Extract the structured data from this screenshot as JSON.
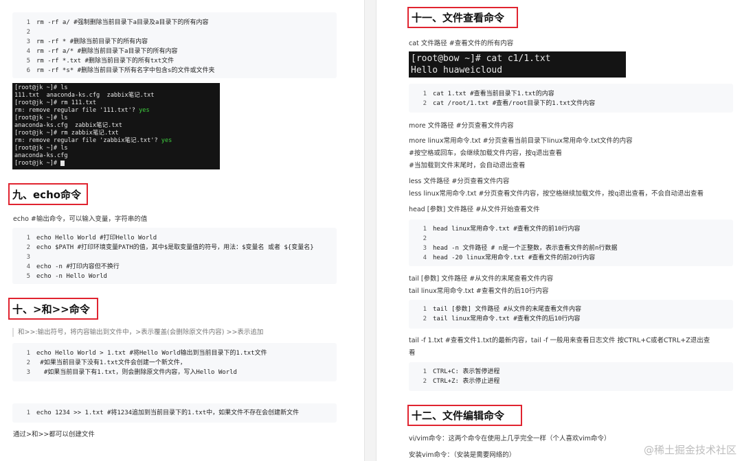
{
  "left": {
    "code1": [
      {
        "n": "1",
        "t": "rm -rf a/ #强制删除当前目录下a目录及a目录下的所有内容"
      },
      {
        "n": "2",
        "t": ""
      },
      {
        "n": "3",
        "t": "rm -rf * #删除当前目录下的所有内容"
      },
      {
        "n": "4",
        "t": "rm -rf a/* #删除当前目录下a目录下的所有内容"
      },
      {
        "n": "5",
        "t": "rm -rf *.txt #删除当前目录下的所有txt文件"
      },
      {
        "n": "6",
        "t": "rm -rf *s* #删除当前目录下所有名字中包含s的文件或文件夹"
      }
    ],
    "terminal1": [
      {
        "t": "[root@jk ~]# ls"
      },
      {
        "t": "111.txt  anaconda-ks.cfg  zabbix笔记.txt"
      },
      {
        "t": "[root@jk ~]# rm 111.txt"
      },
      {
        "t": "rm: remove regular file '111.txt'? ",
        "y": "yes"
      },
      {
        "t": "[root@jk ~]# ls"
      },
      {
        "t": "anaconda-ks.cfg  zabbix笔记.txt"
      },
      {
        "t": "[root@jk ~]# rm zabbix笔记.txt"
      },
      {
        "t": "rm: remove regular file 'zabbix笔记.txt'? ",
        "y": "yes"
      },
      {
        "t": "[root@jk ~]# ls"
      },
      {
        "t": "anaconda-ks.cfg"
      },
      {
        "t": "[root@jk ~]# ",
        "cursor": true
      }
    ],
    "heading_echo": "九、echo命令",
    "echo_desc": "echo #输出命令，可以输入变量，字符串的值",
    "code_echo": [
      {
        "n": "1",
        "t": "echo Hello World #打印Hello World"
      },
      {
        "n": "2",
        "t": "echo $PATH #打印环境变量PATH的值，其中$是取变量值的符号，用法：$变量名 或者 ${变量名}"
      },
      {
        "n": "3",
        "t": ""
      },
      {
        "n": "4",
        "t": "echo -n #打印内容但不换行"
      },
      {
        "n": "5",
        "t": "echo -n Hello World"
      }
    ],
    "heading_redirect": "十、>和>>命令",
    "redirect_quote": "和>>:输出符号，将内容输出到文件中，>表示覆盖(会删除原文件内容) >>表示追加",
    "code_redirect1": [
      {
        "n": "1",
        "t": "echo Hello World > 1.txt #将Hello World输出到当前目录下的1.txt文件"
      },
      {
        "n": "2",
        "t": " #如果当前目录下没有1.txt文件会创建一个新文件，"
      },
      {
        "n": "3",
        "t": "  #如果当前目录下有1.txt，则会删除原文件内容，写入Hello World"
      }
    ],
    "code_redirect2": [
      {
        "n": "1",
        "t": "echo 1234 >> 1.txt #将1234追加到当前目录下的1.txt中，如果文件不存在会创建新文件"
      }
    ],
    "redirect_note": "通过>和>>都可以创建文件"
  },
  "right": {
    "heading_view": "十一、文件查看命令",
    "cat_desc": "cat 文件路径 #查看文件的所有内容",
    "terminal2": [
      {
        "t": "[root@bow ~]# cat c1/1.txt"
      },
      {
        "t": "Hello huaweicloud"
      }
    ],
    "code_cat": [
      {
        "n": "1",
        "t": "cat 1.txt #查看当前目录下1.txt的内容"
      },
      {
        "n": "2",
        "t": "cat /root/1.txt #查看/root目录下的1.txt文件内容"
      }
    ],
    "more_lines": [
      "more 文件路径 #分页查看文件内容",
      "more linux常用命令.txt #分页查看当前目录下linux常用命令.txt文件的内容",
      "#按空格或回车，会继续加载文件内容，按q退出查看",
      "#当加载到文件末尾时，会自动退出查看",
      "less 文件路径 #分页查看文件内容",
      "less linux常用命令.txt #分页查看文件内容，按空格继续加载文件，按q退出查看，不会自动退出查看",
      "head [参数] 文件路径 #从文件开始查看文件"
    ],
    "code_head": [
      {
        "n": "1",
        "t": "head linux常用命令.txt #查看文件的前10行内容"
      },
      {
        "n": "2",
        "t": ""
      },
      {
        "n": "3",
        "t": "head -n 文件路径 # n是一个正整数，表示查看文件的前n行数据"
      },
      {
        "n": "4",
        "t": "head -20 linux常用命令.txt #查看文件的前20行内容"
      }
    ],
    "tail_lines": [
      "tail [参数] 文件路径 #从文件的末尾查看文件内容",
      "tail linux常用命令.txt #查看文件的后10行内容"
    ],
    "code_tail": [
      {
        "n": "1",
        "t": "tail [参数] 文件路径 #从文件的末尾查看文件内容"
      },
      {
        "n": "2",
        "t": "tail linux常用命令.txt #查看文件的后10行内容"
      }
    ],
    "tailf_lines": [
      "tail -f 1.txt #查看文件1.txt的最新内容，tail -f 一般用来查看日志文件 按CTRL+C或者CTRL+Z退出查",
      "看"
    ],
    "code_ctrl": [
      {
        "n": "1",
        "t": "CTRL+C: 表示暂停进程"
      },
      {
        "n": "2",
        "t": "CTRL+Z: 表示停止进程"
      }
    ],
    "heading_edit": "十二、文件编辑命令",
    "vi_lines": [
      "vi/vim命令：这两个命令在使用上几乎完全一样（个人喜欢vim命令）",
      "安装vim命令：（安装是需要网络的）"
    ]
  },
  "watermark": "@稀土掘金技术社区"
}
